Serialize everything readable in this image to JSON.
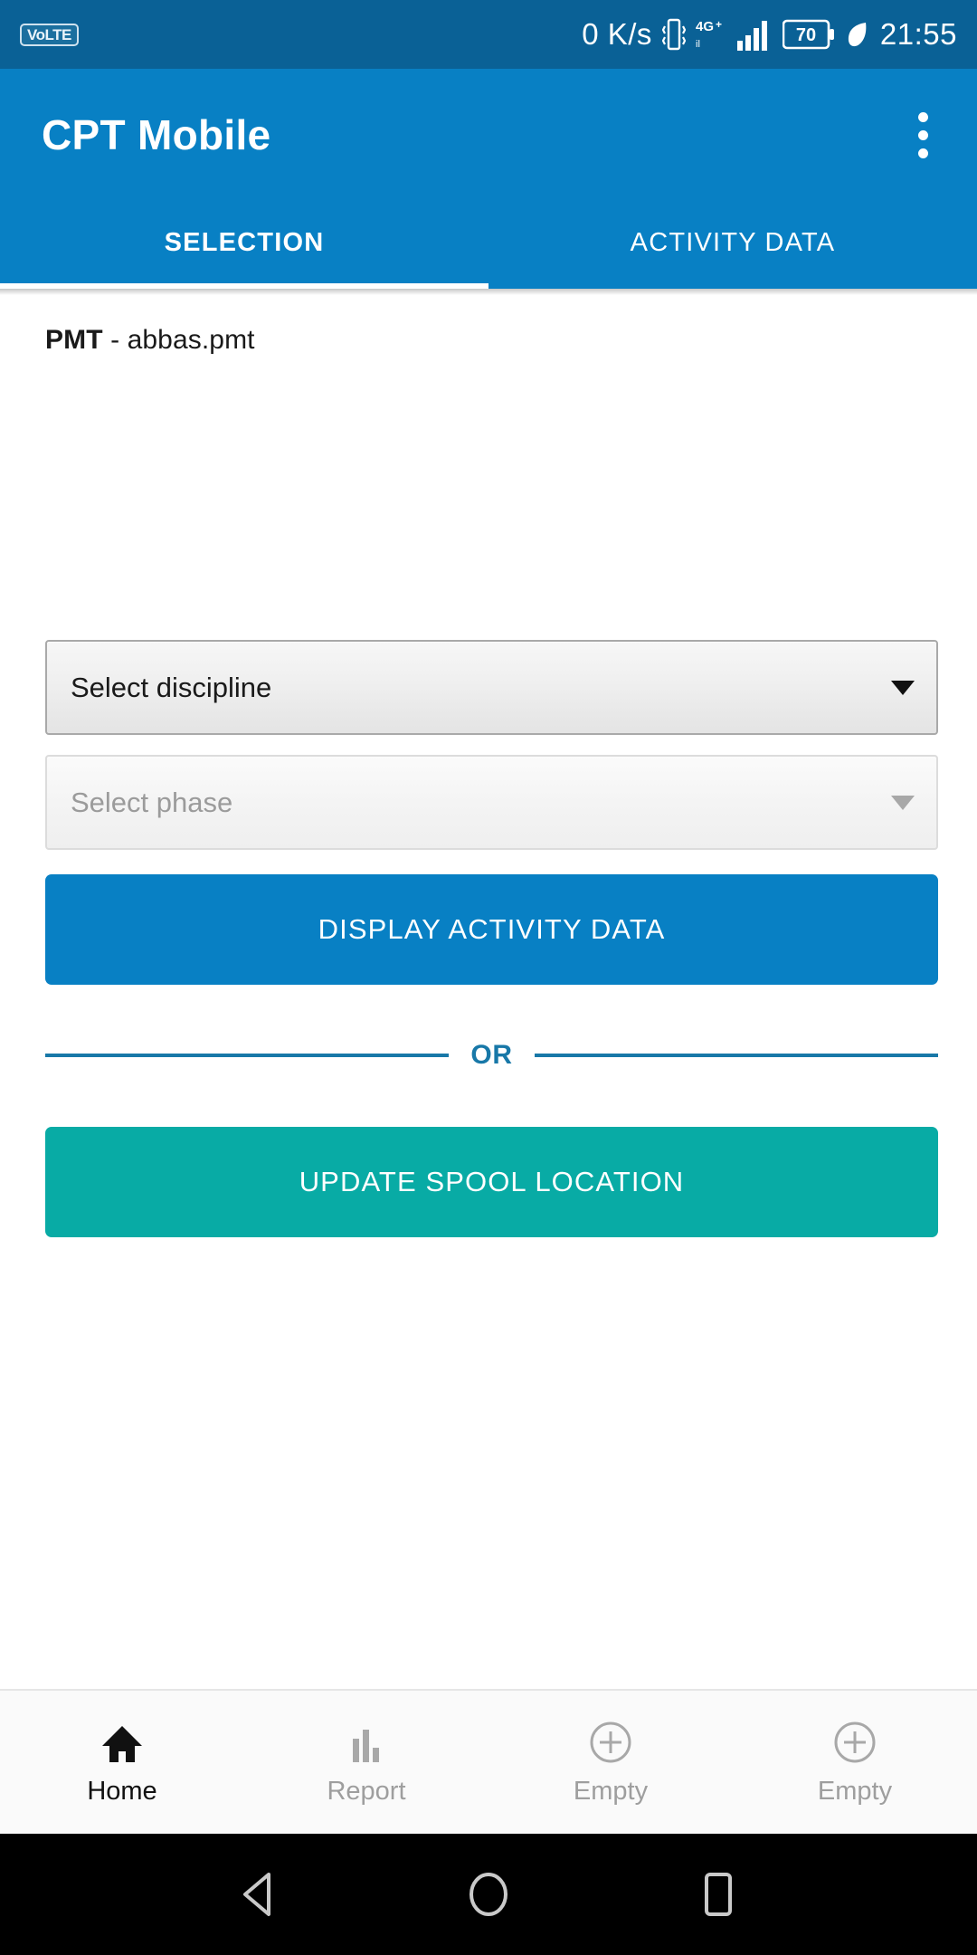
{
  "status_bar": {
    "volte_label": "VoLTE",
    "network_speed": "0 K/s",
    "vibrate_icon": "vibrate-icon",
    "network_type": "4G+",
    "signal_icon": "signal-bars-icon",
    "battery_level": "70",
    "battery_saver_icon": "leaf-icon",
    "time": "21:55"
  },
  "appbar": {
    "title": "CPT Mobile",
    "overflow_icon": "more-vertical-icon"
  },
  "tabs": [
    {
      "label": "SELECTION",
      "active": true
    },
    {
      "label": "ACTIVITY DATA",
      "active": false
    }
  ],
  "content": {
    "pmt_label": "PMT",
    "pmt_separator": " - ",
    "pmt_value": "abbas.pmt",
    "discipline_select": {
      "value": "Select discipline",
      "enabled": true,
      "caret_icon": "chevron-down-icon"
    },
    "phase_select": {
      "value": "Select phase",
      "enabled": false,
      "caret_icon": "chevron-down-icon"
    },
    "display_button": "DISPLAY ACTIVITY DATA",
    "divider_text": "OR",
    "update_button": "UPDATE SPOOL LOCATION"
  },
  "bottom_nav": [
    {
      "label": "Home",
      "icon": "home-icon",
      "active": true
    },
    {
      "label": "Report",
      "icon": "bar-chart-icon",
      "active": false
    },
    {
      "label": "Empty",
      "icon": "plus-circle-icon",
      "active": false
    },
    {
      "label": "Empty",
      "icon": "plus-circle-icon",
      "active": false
    }
  ],
  "system_nav": {
    "back_icon": "back-triangle-icon",
    "home_icon": "home-circle-icon",
    "recents_icon": "recents-square-icon"
  },
  "colors": {
    "status_bar": "#0a6196",
    "app_bar": "#0880c4",
    "primary_button": "#0880c4",
    "teal_button": "#08aba5",
    "divider": "#1878a8"
  }
}
